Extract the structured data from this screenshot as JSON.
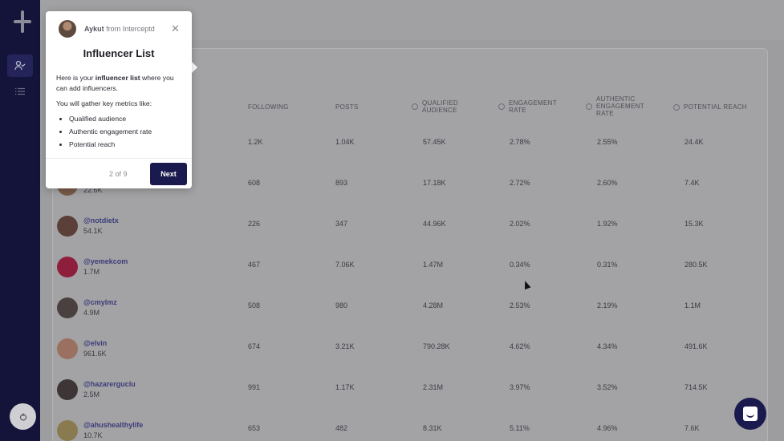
{
  "sidebar": {
    "logo_icon": "plus-logo",
    "items": [
      {
        "icon": "user-check-icon",
        "active": true
      },
      {
        "icon": "list-icon",
        "active": false
      }
    ],
    "user_icon": "power-icon"
  },
  "table": {
    "headers": [
      {
        "label": "FOLLOWING",
        "info": false
      },
      {
        "label": "POSTS",
        "info": false
      },
      {
        "label": "QUALIFIED AUDIENCE",
        "info": true
      },
      {
        "label": "ENGAGEMENT RATE",
        "info": true
      },
      {
        "label": "AUTHENTIC ENGAGEMENT RATE",
        "info": true
      },
      {
        "label": "POTENTIAL REACH",
        "info": true
      }
    ],
    "rows": [
      {
        "handle": "",
        "followers": "",
        "following": "1.2K",
        "posts": "1.04K",
        "qualified": "57.45K",
        "engagement": "2.78%",
        "authentic": "2.55%",
        "reach": "24.4K",
        "avatar_color": "#8a6a58"
      },
      {
        "handle": "",
        "followers": "22.6K",
        "following": "608",
        "posts": "893",
        "qualified": "17.18K",
        "engagement": "2.72%",
        "authentic": "2.60%",
        "reach": "7.4K",
        "avatar_color": "#7b5a48"
      },
      {
        "handle": "@notdietx",
        "followers": "54.1K",
        "following": "226",
        "posts": "347",
        "qualified": "44.96K",
        "engagement": "2.02%",
        "authentic": "1.92%",
        "reach": "15.3K",
        "avatar_color": "#5a4038"
      },
      {
        "handle": "@yemekcom",
        "followers": "1.7M",
        "following": "467",
        "posts": "7.06K",
        "qualified": "1.47M",
        "engagement": "0.34%",
        "authentic": "0.31%",
        "reach": "280.5K",
        "avatar_color": "#8e1f3c"
      },
      {
        "handle": "@cmylmz",
        "followers": "4.9M",
        "following": "508",
        "posts": "980",
        "qualified": "4.28M",
        "engagement": "2.53%",
        "authentic": "2.19%",
        "reach": "1.1M",
        "avatar_color": "#4a4040"
      },
      {
        "handle": "@elvin",
        "followers": "961.6K",
        "following": "674",
        "posts": "3.21K",
        "qualified": "790.28K",
        "engagement": "4.62%",
        "authentic": "4.34%",
        "reach": "491.6K",
        "avatar_color": "#9a7060"
      },
      {
        "handle": "@hazarerguclu",
        "followers": "2.5M",
        "following": "991",
        "posts": "1.17K",
        "qualified": "2.31M",
        "engagement": "3.97%",
        "authentic": "3.52%",
        "reach": "714.5K",
        "avatar_color": "#3e3636"
      },
      {
        "handle": "@ahushealthylife",
        "followers": "10.7K",
        "following": "653",
        "posts": "482",
        "qualified": "8.31K",
        "engagement": "5.11%",
        "authentic": "4.96%",
        "reach": "7.6K",
        "avatar_color": "#8a7a50"
      }
    ]
  },
  "tour": {
    "author": "Aykut",
    "from_text": "from Interceptd",
    "title": "Influencer List",
    "intro_prefix": "Here is your ",
    "intro_bold": "influencer list",
    "intro_suffix": " where you can add influencers.",
    "metrics_intro": "You will gather key metrics like:",
    "metrics": [
      "Qualified audience",
      "Authentic engagement rate",
      "Potential reach"
    ],
    "step": "2 of 9",
    "next_label": "Next",
    "close_icon": "close-icon"
  },
  "chat": {
    "icon": "chat-icon"
  },
  "colors": {
    "sidebar": "#14143a",
    "accent": "#1b1a4f",
    "overlay": "#9d9d9f"
  }
}
